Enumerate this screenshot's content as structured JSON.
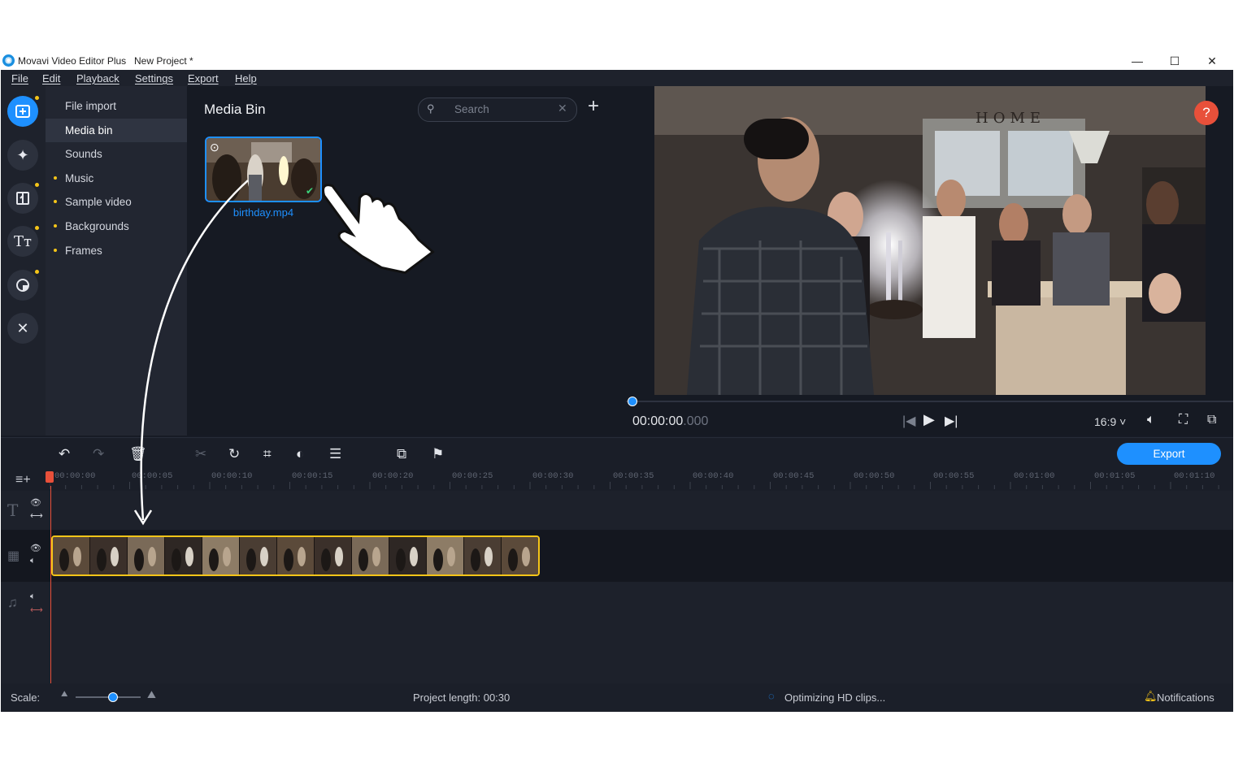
{
  "window": {
    "app_name": "Movavi Video Editor Plus",
    "project_name": "New Project *",
    "minimize": "—",
    "maximize": "☐",
    "close": "✕"
  },
  "menu": [
    "File",
    "Edit",
    "Playback",
    "Settings",
    "Export",
    "Help"
  ],
  "nav": {
    "items": [
      {
        "label": "File import",
        "dot": false
      },
      {
        "label": "Media bin",
        "dot": false
      },
      {
        "label": "Sounds",
        "dot": false
      },
      {
        "label": "Music",
        "dot": true
      },
      {
        "label": "Sample video",
        "dot": true
      },
      {
        "label": "Backgrounds",
        "dot": true
      },
      {
        "label": "Frames",
        "dot": true
      }
    ],
    "selected": "Media bin"
  },
  "media_bin": {
    "title": "Media Bin",
    "search_placeholder": "Search",
    "add_symbol": "+",
    "files": [
      {
        "name": "birthday.mp4"
      }
    ]
  },
  "preview": {
    "help": "?",
    "timecode_main": "00:00:00",
    "timecode_ms": ".000",
    "aspect_ratio": "16:9 ˅",
    "video_sign": "HOME"
  },
  "timeline": {
    "export_label": "Export",
    "ruler": [
      "00:00:00",
      "00:00:05",
      "00:00:10",
      "00:00:15",
      "00:00:20",
      "00:00:25",
      "00:00:30",
      "00:00:35",
      "00:00:40",
      "00:00:45",
      "00:00:50",
      "00:00:55",
      "00:01:00",
      "00:01:05",
      "00:01:10"
    ]
  },
  "status": {
    "scale_label": "Scale:",
    "scale_level": 0.58,
    "project_length": "Project length: 00:30",
    "optimizing": "Optimizing HD clips...",
    "notifications": "Notifications"
  },
  "colors": {
    "accent": "#1e90ff",
    "clip_border": "#f5c518",
    "playhead": "#e8503a"
  }
}
